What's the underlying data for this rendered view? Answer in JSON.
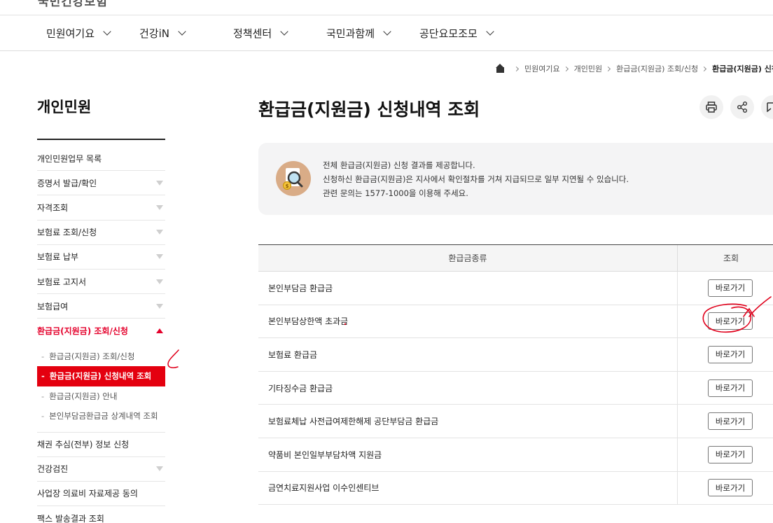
{
  "header": {
    "brand": "국민건강보험",
    "nav": [
      {
        "label": "민원여기요",
        "icon": "chevron-down-icon"
      },
      {
        "label": "건강iN",
        "icon": "chevron-down-icon"
      },
      {
        "label": "정책센터",
        "icon": "chevron-down-icon"
      },
      {
        "label": "국민과함께",
        "icon": "chevron-down-icon"
      },
      {
        "label": "공단요모조모",
        "icon": "chevron-down-icon"
      }
    ]
  },
  "breadcrumb": {
    "home_icon": "home-icon",
    "items": [
      "민원여기요",
      "개인민원",
      "환급금(지원금) 조회/신청",
      "환급금(지원금) 신청내역 조회"
    ]
  },
  "sidebar": {
    "title": "개인민원",
    "items": [
      {
        "label": "개인민원업무 목록",
        "expandable": false
      },
      {
        "label": "증명서 발급/확인",
        "expandable": true
      },
      {
        "label": "자격조회",
        "expandable": true
      },
      {
        "label": "보험료 조회/신청",
        "expandable": true
      },
      {
        "label": "보험료 납부",
        "expandable": true
      },
      {
        "label": "보험료 고지서",
        "expandable": true
      },
      {
        "label": "보험급여",
        "expandable": true
      },
      {
        "label": "환급금(지원금) 조회/신청",
        "expandable": true,
        "active": true
      }
    ],
    "sub_items": [
      {
        "label": "환급금(지원금) 조회/신청"
      },
      {
        "label": "환급금(지원금) 신청내역 조회",
        "current": true
      },
      {
        "label": "환급금(지원금) 안내"
      },
      {
        "label": "본인부담금환급금 상계내역 조회"
      }
    ],
    "items_after": [
      {
        "label": "채권 추심(전부) 정보 신청",
        "expandable": false
      },
      {
        "label": "건강검진",
        "expandable": true
      },
      {
        "label": "사업장 의료비 자료제공 동의",
        "expandable": false
      },
      {
        "label": "팩스 발송결과 조회",
        "expandable": false
      }
    ]
  },
  "main": {
    "title": "환급금(지원금) 신청내역 조회",
    "tools": [
      {
        "icon": "print-icon"
      },
      {
        "icon": "share-icon"
      },
      {
        "icon": "bookmark-icon"
      }
    ],
    "info": {
      "icon": "search-money-icon",
      "lines": [
        "전체 환급금(지원금) 신청 결과를 제공합니다.",
        "신청하신 환급금(지원금)은 지사에서 확인절차를 거쳐 지급되므로 일부 지연될 수 있습니다.",
        "관련 문의는 1577-1000을 이용해 주세요."
      ]
    },
    "table": {
      "headers": [
        "환급금종류",
        "조회"
      ],
      "button_label": "바로가기",
      "rows": [
        "본인부담금 환급금",
        "본인부담상한액 초과금",
        "보험료 환급금",
        "기타징수금 환급금",
        "보험료체납 사전급여제한해제 공단부담금 환급금",
        "약품비 본인일부부담차액 지원금",
        "금연치료지원사업 이수인센티브"
      ]
    }
  },
  "annotation_color": "#e0001b"
}
